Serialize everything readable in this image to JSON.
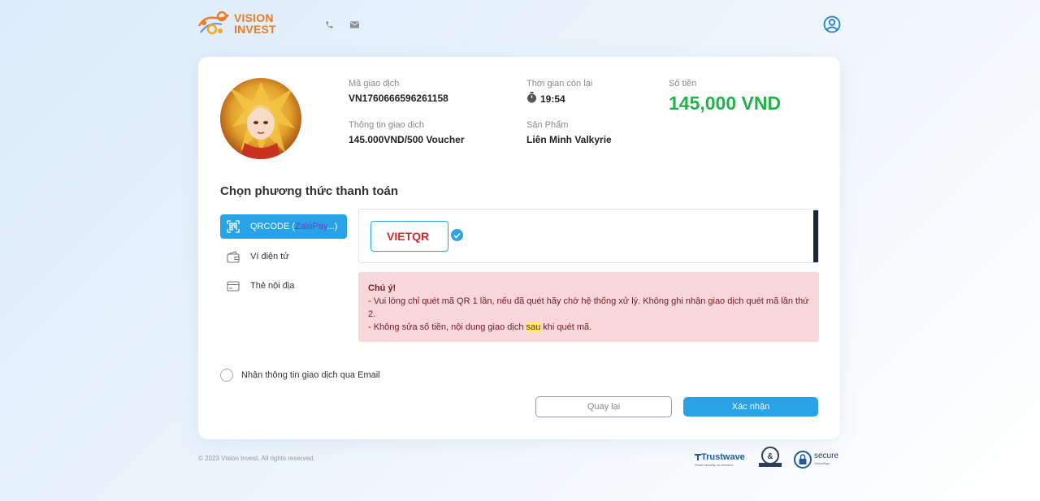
{
  "header": {
    "brand_line1": "VISION",
    "brand_line2": "INVEST",
    "icons": [
      "phone-icon",
      "mail-icon",
      "user-icon"
    ]
  },
  "transaction": {
    "code_label": "Mã giao dịch",
    "code_value": "VN1760666596261158",
    "time_label": "Thời gian còn lại",
    "time_value": "19:54",
    "amount_label": "Số tiền",
    "amount_value": "145,000 VND",
    "info_label": "Thông tin giao dịch",
    "info_value": "145.000VND/500 Voucher",
    "product_label": "Sản Phẩm",
    "product_value": "Liên Minh Valkyrie"
  },
  "payment": {
    "title": "Chọn phương thức thanh toán",
    "methods": [
      {
        "label_prefix": "QRCODE (",
        "label_brand": "ZaloPay",
        "label_suffix": "...)",
        "active": true
      },
      {
        "label": "Ví điện tử",
        "active": false
      },
      {
        "label": "Thẻ nội địa",
        "active": false
      }
    ],
    "selected_bank": "VIETQR"
  },
  "notice": {
    "title": "Chú ý!",
    "line1": "- Vui lòng chỉ quét mã QR 1 lần, nếu đã quét hãy chờ hệ thống xử lý. Không ghi nhận giao dịch quét mã lần thứ 2.",
    "line2_a": "- Không sửa số tiền, nội dung giao dịch ",
    "line2_hl": "sau",
    "line2_b": " khi quét mã."
  },
  "email_option": "Nhận thông tin giao dịch qua Email",
  "buttons": {
    "back": "Quay lại",
    "confirm": "Xác nhận"
  },
  "footer": {
    "copyright": "© 2023 Vision Invest. All rights reserved.",
    "trustwave": "Trustwave",
    "trustwave_tag": "Smart security on demand",
    "secure": "secure",
    "secure_sub": "GlobalSign"
  },
  "colors": {
    "accent": "#29a3e8",
    "amount": "#22b24c",
    "brand": "#f07b22",
    "notice_bg": "#f8d7da"
  }
}
